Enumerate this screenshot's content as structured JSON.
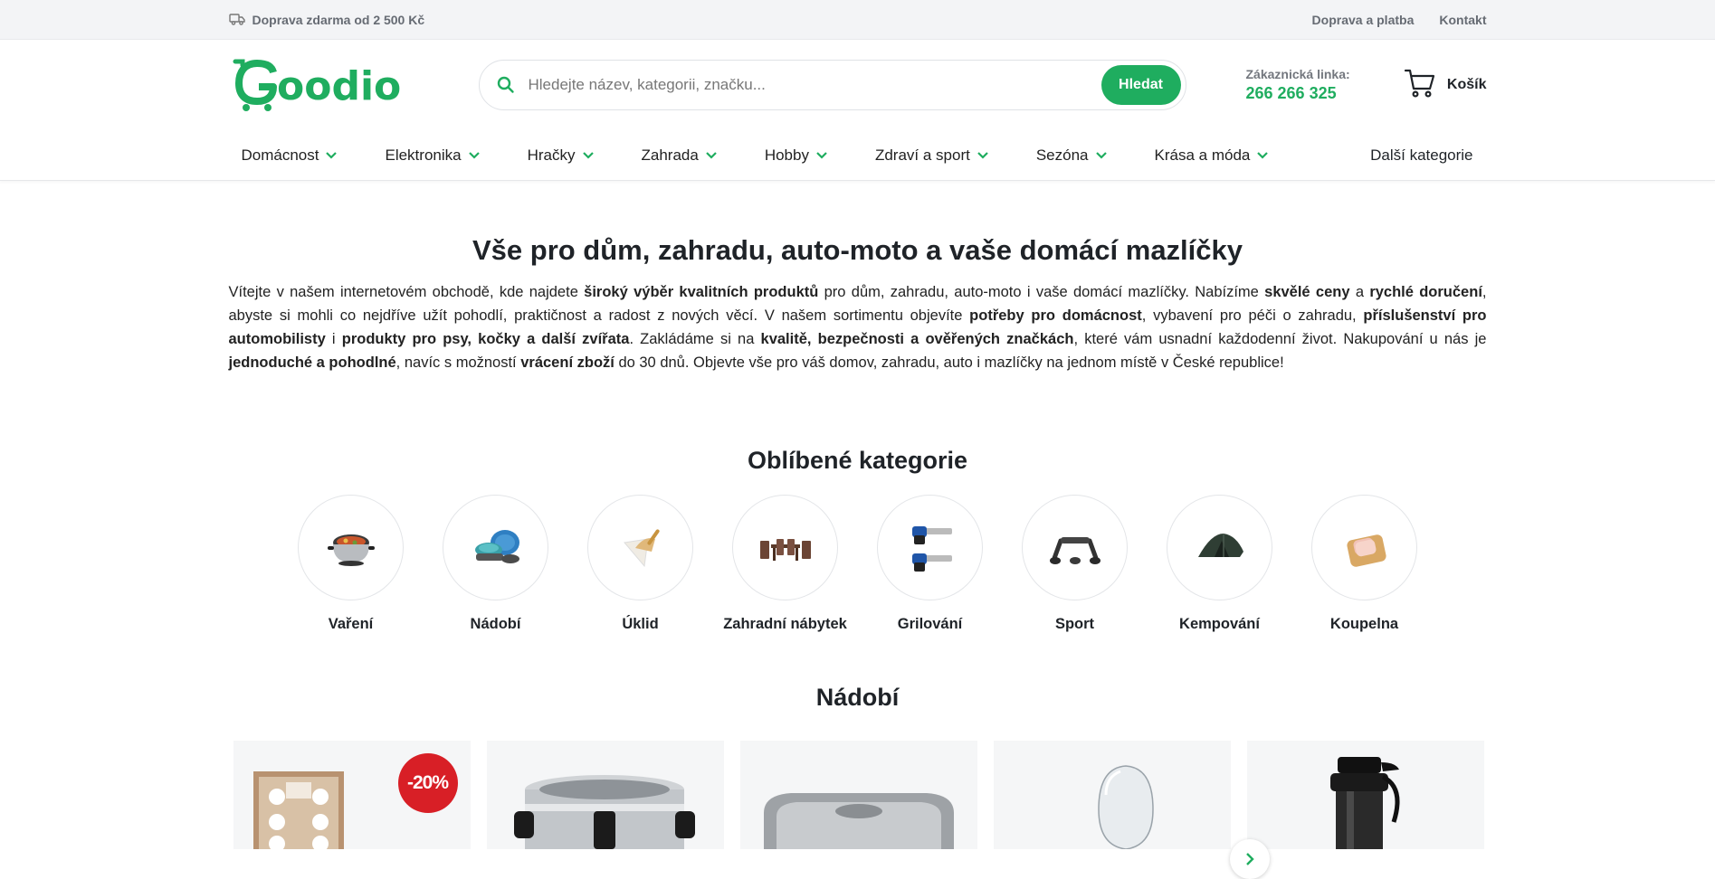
{
  "topbar": {
    "free_shipping": "Doprava zdarma od 2 500 Kč",
    "links": [
      "Doprava a platba",
      "Kontakt"
    ]
  },
  "header": {
    "logo_text": "Goodio",
    "search_placeholder": "Hledejte název, kategorii, značku...",
    "search_button": "Hledat",
    "hotline_label": "Zákaznická linka:",
    "hotline_number": "266 266 325",
    "cart_label": "Košík"
  },
  "nav": {
    "items": [
      "Domácnost",
      "Elektronika",
      "Hračky",
      "Zahrada",
      "Hobby",
      "Zdraví a sport",
      "Sezóna",
      "Krása a móda"
    ],
    "more": "Další kategorie"
  },
  "intro": {
    "title": "Vše pro dům, zahradu, auto-moto a vaše domácí mazlíčky",
    "parts": [
      "Vítejte v našem internetovém obchodě, kde najdete ",
      "široký výběr kvalitních produktů",
      " pro dům, zahradu, auto-moto i vaše domácí mazlíčky. Nabízíme ",
      "skvělé ceny",
      " a ",
      "rychlé doručení",
      ", abyste si mohli co nejdříve užít pohodlí, praktičnost a radost z nových věcí. V našem sortimentu objevíte ",
      "potřeby pro domácnost",
      ", vybavení pro péči o zahradu, ",
      "příslušenství pro automobilisty",
      " i ",
      "produkty pro psy, kočky a další zvířata",
      ". Zakládáme si na ",
      "kvalitě, bezpečnosti a ověřených značkách",
      ", které vám usnadní každodenní život. Nakupování u nás je ",
      "jednoduché a pohodlné",
      ", navíc s možností ",
      "vrácení zboží",
      " do 30 dnů. Objevte vše pro váš domov, zahradu, auto i mazlíčky na jednom místě v České republice!"
    ]
  },
  "categories": {
    "title": "Oblíbené kategorie",
    "items": [
      "Vaření",
      "Nádobí",
      "Úklid",
      "Zahradní nábytek",
      "Grilování",
      "Sport",
      "Kempování",
      "Koupelna"
    ]
  },
  "products": {
    "title": "Nádobí",
    "discount_badge": "-20%"
  },
  "colors": {
    "brand_green": "#1fad5f",
    "discount_red": "#d81f26",
    "topbar_bg": "#f3f4f6"
  }
}
